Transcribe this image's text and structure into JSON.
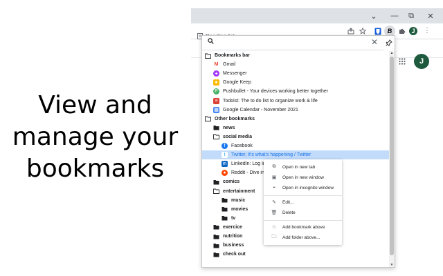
{
  "promo": {
    "line1": "View and",
    "line2": "manage your",
    "line3": "bookmarks"
  },
  "window": {
    "minimize": "—",
    "restore": "⧉",
    "close": "✕",
    "tab_search": "⌄"
  },
  "toolbar": {
    "share_icon": "share-icon",
    "star_icon": "star-icon",
    "extension_label": "B",
    "avatar_letter": "J"
  },
  "bookmarks_bar": {
    "reading_list": "Reading list",
    "avatar_letter": "J"
  },
  "popup": {
    "search_placeholder": "",
    "tree": [
      {
        "label": "Bookmarks bar",
        "kind": "folder"
      },
      {
        "label": "Gmail",
        "kind": "link",
        "icon": "gmail",
        "color": "#ea4335"
      },
      {
        "label": "Messenger",
        "kind": "link",
        "icon": "messenger",
        "color": "#a334fa"
      },
      {
        "label": "Google Keep",
        "kind": "link",
        "icon": "keep",
        "color": "#fbbc04"
      },
      {
        "label": "Pushbullet - Your devices working better together",
        "kind": "link",
        "icon": "pushbullet",
        "color": "#4ab367"
      },
      {
        "label": "Todoist: The to do list to organize work & life",
        "kind": "link",
        "icon": "todoist",
        "color": "#db4035"
      },
      {
        "label": "Google Calendar - November 2021",
        "kind": "link",
        "icon": "calendar",
        "color": "#4285f4"
      },
      {
        "label": "Other bookmarks",
        "kind": "folder"
      },
      {
        "label": "news",
        "kind": "folder-filled"
      },
      {
        "label": "social media",
        "kind": "folder"
      },
      {
        "label": "Facebook",
        "kind": "link",
        "icon": "facebook",
        "color": "#1877f2"
      },
      {
        "label": "Twitter. It's what's happening / Twitter",
        "kind": "link",
        "icon": "twitter",
        "color": "#1da1f2"
      },
      {
        "label": "LinkedIn: Log In",
        "kind": "link",
        "icon": "linkedin",
        "color": "#0a66c2"
      },
      {
        "label": "Reddit - Dive into",
        "kind": "link",
        "icon": "reddit",
        "color": "#ff4500"
      },
      {
        "label": "comics",
        "kind": "folder-filled"
      },
      {
        "label": "entertainment",
        "kind": "folder"
      },
      {
        "label": "music",
        "kind": "folder-filled"
      },
      {
        "label": "movies",
        "kind": "folder-filled"
      },
      {
        "label": "tv",
        "kind": "folder-filled"
      },
      {
        "label": "exercice",
        "kind": "folder-filled"
      },
      {
        "label": "nutrition",
        "kind": "folder-filled"
      },
      {
        "label": "business",
        "kind": "folder-filled"
      },
      {
        "label": "check out",
        "kind": "folder-filled"
      }
    ]
  },
  "context_menu": {
    "open_new_tab": "Open in new tab",
    "open_new_window": "Open in new window",
    "open_incognito": "Open in incognito window",
    "edit": "Edit...",
    "delete": "Delete",
    "add_bookmark_above": "Add bookmark above",
    "add_folder_above": "Add folder above..."
  },
  "colors": {
    "selection": "#c2dbfb",
    "titlebar": "#dee1e6",
    "avatar": "#1e5b3e"
  }
}
